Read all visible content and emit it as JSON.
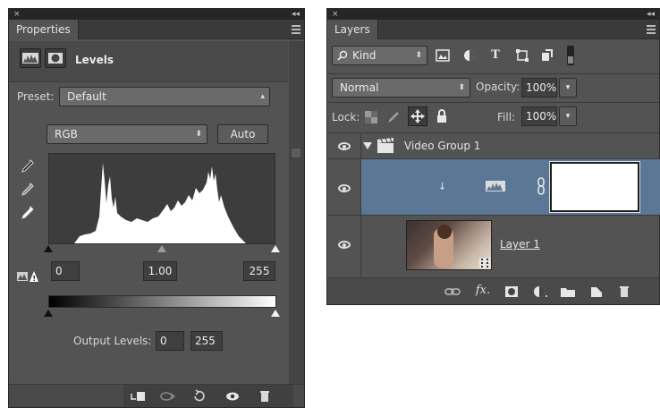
{
  "properties": {
    "close_glyph": "×",
    "collapse_glyph": "◂◂",
    "tab_label": "Properties",
    "title": "Levels",
    "preset_label": "Preset:",
    "preset_value": "Default",
    "channel_value": "RGB",
    "auto_label": "Auto",
    "input_black": "0",
    "input_gamma": "1.00",
    "input_white": "255",
    "output_label": "Output Levels:",
    "output_black": "0",
    "output_white": "255"
  },
  "layers": {
    "close_glyph": "×",
    "collapse_glyph": "◂◂",
    "tab_label": "Layers",
    "filter_kind": "Kind",
    "blend_mode": "Normal",
    "opacity_label": "Opacity:",
    "opacity_value": "100%",
    "lock_label": "Lock:",
    "fill_label": "Fill:",
    "fill_value": "100%",
    "group_name": "Video Group 1",
    "layer_name": "Layer 1"
  },
  "colors": {
    "panel_bg": "#535353",
    "selected_row": "#5a7896",
    "title_bar": "#262626"
  }
}
